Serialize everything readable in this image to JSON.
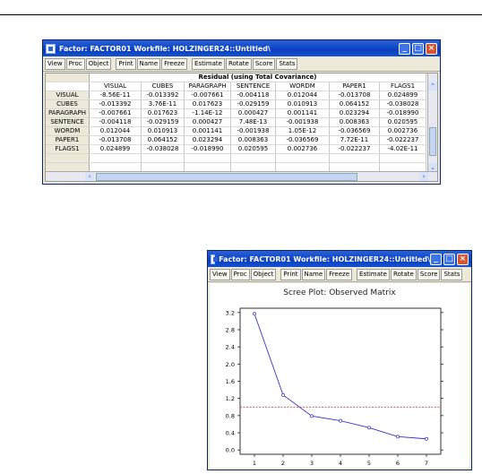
{
  "residual_window": {
    "title": "Factor: FACTOR01   Workfile: HOLZINGER24::Untitled\\",
    "toolbar": [
      "View",
      "Proc",
      "Object",
      "Print",
      "Name",
      "Freeze",
      "Estimate",
      "Rotate",
      "Score",
      "Stats"
    ],
    "table_title": "Residual (using Total Covariance)",
    "columns": [
      "VISUAL",
      "CUBES",
      "PARAGRAPH",
      "SENTENCE",
      "WORDM",
      "PAPER1",
      "FLAGS1"
    ],
    "rows": [
      {
        "label": "VISUAL",
        "values": [
          "-8.56E-11",
          "-0.013392",
          "-0.007661",
          "-0.004118",
          "0.012044",
          "-0.013708",
          "0.024899"
        ]
      },
      {
        "label": "CUBES",
        "values": [
          "-0.013392",
          "3.76E-11",
          "0.017623",
          "-0.029159",
          "0.010913",
          "0.064152",
          "-0.038028"
        ]
      },
      {
        "label": "PARAGRAPH",
        "values": [
          "-0.007661",
          "0.017623",
          "-1.14E-12",
          "0.000427",
          "0.001141",
          "0.023294",
          "-0.018990"
        ]
      },
      {
        "label": "SENTENCE",
        "values": [
          "-0.004118",
          "-0.029159",
          "0.000427",
          "7.48E-13",
          "-0.001938",
          "0.008363",
          "0.020595"
        ]
      },
      {
        "label": "WORDM",
        "values": [
          "0.012044",
          "0.010913",
          "0.001141",
          "-0.001938",
          "1.05E-12",
          "-0.036569",
          "0.002736"
        ]
      },
      {
        "label": "PAPER1",
        "values": [
          "-0.013708",
          "0.064152",
          "0.023294",
          "0.008363",
          "-0.036569",
          "7.72E-11",
          "-0.022237"
        ]
      },
      {
        "label": "FLAGS1",
        "values": [
          "0.024899",
          "-0.038028",
          "-0.018990",
          "0.020595",
          "0.002736",
          "-0.022237",
          "-4.02E-11"
        ]
      }
    ]
  },
  "scree_window": {
    "title": "Factor: FACTOR01   Workfile: HOLZINGER24::Untitled\\",
    "toolbar": [
      "View",
      "Proc",
      "Object",
      "Print",
      "Name",
      "Freeze",
      "Estimate",
      "Rotate",
      "Score",
      "Stats"
    ]
  },
  "chart_data": {
    "type": "line",
    "title": "Scree Plot: Observed Matrix",
    "x": [
      1,
      2,
      3,
      4,
      5,
      6,
      7
    ],
    "values": [
      3.17,
      1.28,
      0.79,
      0.68,
      0.52,
      0.31,
      0.26
    ],
    "reference_line": 1.0,
    "ylim": [
      -0.1,
      3.3
    ],
    "yticks": [
      "0.0",
      "0.4",
      "0.8",
      "1.2",
      "1.6",
      "2.0",
      "2.4",
      "2.8",
      "3.2"
    ],
    "xticks": [
      "1",
      "2",
      "3",
      "4",
      "5",
      "6",
      "7"
    ],
    "line_color": "#3333cc",
    "reference_color": "#cc2222"
  }
}
